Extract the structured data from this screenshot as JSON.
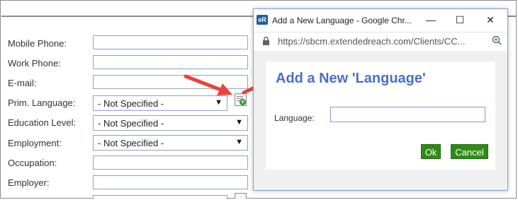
{
  "form": {
    "fields": [
      {
        "label": "Mobile Phone:",
        "type": "text",
        "value": ""
      },
      {
        "label": "Work Phone:",
        "type": "text",
        "value": ""
      },
      {
        "label": "E-mail:",
        "type": "text",
        "value": ""
      },
      {
        "label": "Prim. Language:",
        "type": "select",
        "value": "- Not Specified -"
      },
      {
        "label": "Education Level:",
        "type": "select",
        "value": "- Not Specified -"
      },
      {
        "label": "Employment:",
        "type": "select",
        "value": "- Not Specified -"
      },
      {
        "label": "Occupation:",
        "type": "text",
        "value": ""
      },
      {
        "label": "Employer:",
        "type": "text",
        "value": ""
      }
    ],
    "dropdown_arrow": "▼",
    "add_button_icon": "add-list-icon"
  },
  "popup": {
    "window_title": "Add a New Language - Google Chr...",
    "app_icon_text": "eR",
    "controls": {
      "minimize": "—",
      "maximize": "☐",
      "close": "✕"
    },
    "url": "https://sbcm.extendedreach.com/Clients/CC...",
    "dialog_title": "Add a New 'Language'",
    "language_label": "Language:",
    "language_value": "",
    "ok_label": "Ok",
    "cancel_label": "Cancel"
  },
  "colors": {
    "arrow": "#e8433a",
    "dialog_title": "#4a6fc4",
    "button_green": "#2e8b17"
  }
}
